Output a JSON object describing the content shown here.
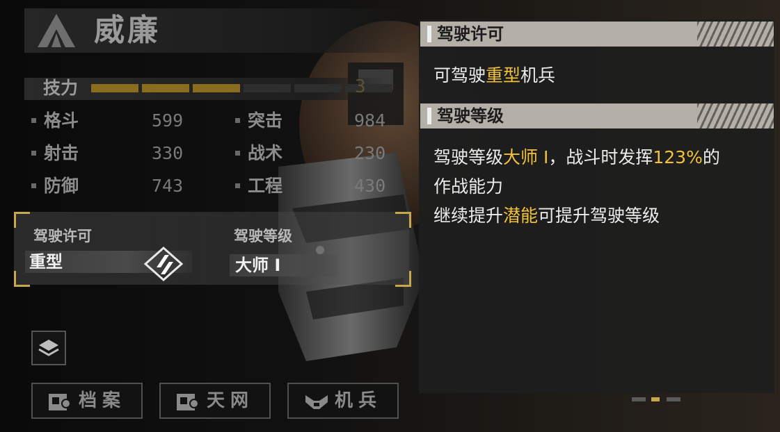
{
  "character": {
    "name": "威廉"
  },
  "skill": {
    "label": "技力",
    "value": "3",
    "segments_total": 6,
    "segments_filled": 3
  },
  "stats": [
    {
      "label": "格斗",
      "value": "599"
    },
    {
      "label": "突击",
      "value": "984"
    },
    {
      "label": "射击",
      "value": "330"
    },
    {
      "label": "战术",
      "value": "230"
    },
    {
      "label": "防御",
      "value": "743"
    },
    {
      "label": "工程",
      "value": "430"
    }
  ],
  "pilot_card": {
    "license_label": "驾驶许可",
    "license_value": "重型",
    "level_label": "驾驶等级",
    "level_value": "大师 I"
  },
  "buttons": {
    "archive": "档案",
    "skynet": "天网",
    "mech": "机兵"
  },
  "panel": {
    "license_title": "驾驶许可",
    "license_line": {
      "before": "可驾驶",
      "highlight": "重型",
      "after": "机兵"
    },
    "level_title": "驾驶等级",
    "level_line1": {
      "before": "驾驶等级",
      "highlight": "大师 I",
      "mid": "，战斗时发挥",
      "highlight2": "123%",
      "after": "的"
    },
    "level_line2": "作战能力",
    "level_line3": {
      "before": "继续提升",
      "highlight": "潜能",
      "after": "可提升驾驶等级"
    }
  },
  "pager": {
    "pages": 3,
    "active": 2
  },
  "colors": {
    "accent_gold": "#f2c23c",
    "skill_fill": "#8a6d1e",
    "skill_empty": "#2e2e2e",
    "section_header": "#b4b0a8",
    "panel_bg": "#1e1e1e"
  },
  "icons": [
    "emblem-icon",
    "layers-icon",
    "archive-icon",
    "skynet-icon",
    "mech-icon",
    "pilot-emblem-icon"
  ]
}
